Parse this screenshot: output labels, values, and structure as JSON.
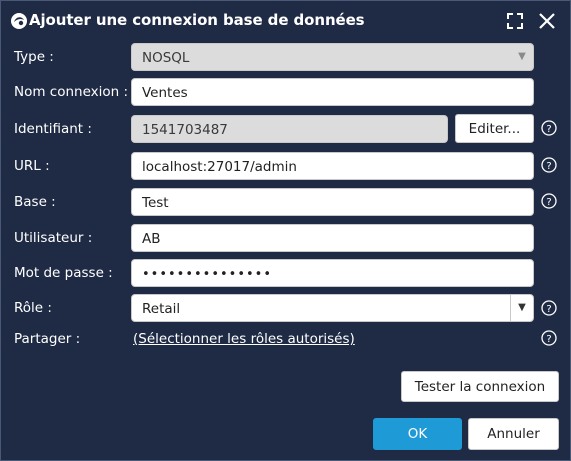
{
  "dialog": {
    "title": "Ajouter une connexion base de données",
    "icons": {
      "app": "database-connection-icon",
      "maximize": "maximize-icon",
      "close": "close-icon"
    }
  },
  "form": {
    "type": {
      "label": "Type :",
      "value": "NOSQL"
    },
    "name": {
      "label": "Nom connexion :",
      "value": "Ventes"
    },
    "identifier": {
      "label": "Identifiant :",
      "value": "1541703487",
      "edit_button": "Editer..."
    },
    "url": {
      "label": "URL :",
      "value": "localhost:27017/admin"
    },
    "base": {
      "label": "Base :",
      "value": "Test"
    },
    "user": {
      "label": "Utilisateur :",
      "value": "AB"
    },
    "password": {
      "label": "Mot de passe :",
      "value": "•••••••••••••••"
    },
    "role": {
      "label": "Rôle :",
      "value": "Retail"
    },
    "share": {
      "label": "Partager :",
      "link": "(Sélectionner les rôles autorisés)"
    }
  },
  "buttons": {
    "test_connection": "Tester la connexion",
    "ok": "OK",
    "cancel": "Annuler"
  },
  "colors": {
    "background": "#1f2b45",
    "primary": "#1e9ad6",
    "disabled_field": "#dcdcdc"
  }
}
